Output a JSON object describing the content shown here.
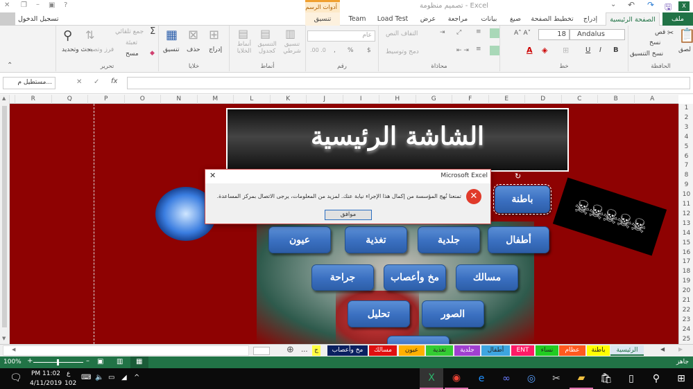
{
  "title": {
    "text": "تصميم منظومة - Excel",
    "context_group": "أدوات الرسم",
    "signin": "تسجيل الدخول"
  },
  "tabs": [
    "ملف",
    "الصفحة الرئيسية",
    "إدراج",
    "تخطيط الصفحة",
    "صيغ",
    "بيانات",
    "مراجعة",
    "عرض",
    "Load Test",
    "Team",
    "تنسيق"
  ],
  "ribbon": {
    "clipboard": {
      "label": "الحافظة",
      "paste": "لصق",
      "cut": "قص",
      "copy": "نسخ",
      "format_painter": "نسخ التنسيق"
    },
    "font": {
      "label": "خط",
      "name": "Andalus",
      "size": "18",
      "bold": "B",
      "italic": "I",
      "underline": "U"
    },
    "alignment": {
      "label": "محاذاة",
      "wrap": "التفاف النص",
      "merge": "دمج وتوسيط"
    },
    "number": {
      "label": "رقم",
      "format": "عام",
      "currency": "$",
      "percent": "%",
      "comma": ","
    },
    "styles": {
      "label": "أنماط",
      "conditional": "تنسيق شرطي",
      "as_table": "التنسيق كجدول",
      "cell_styles": "أنماط الخلايا"
    },
    "cells": {
      "label": "خلايا",
      "insert": "إدراج",
      "delete": "حذف",
      "format": "تنسيق"
    },
    "editing": {
      "label": "تحرير",
      "autosum": "جمع تلقائي",
      "fill": "تعبئة",
      "clear": "مسح",
      "sort": "فرز وتصفية",
      "find": "بحث وتحديد"
    }
  },
  "formula_bar": {
    "name_box": "مستطيل م...",
    "cancel": "✕",
    "enter": "✓",
    "fx": "fx",
    "value": ""
  },
  "columns": [
    "A",
    "B",
    "C",
    "D",
    "E",
    "F",
    "G",
    "H",
    "I",
    "J",
    "K",
    "L",
    "M",
    "N",
    "O",
    "P",
    "Q",
    "R"
  ],
  "rows": [
    "1",
    "2",
    "3",
    "4",
    "5",
    "6",
    "7",
    "8",
    "9",
    "10",
    "11",
    "12",
    "13",
    "14",
    "15",
    "16",
    "17",
    "18",
    "19",
    "20",
    "21",
    "22",
    "23",
    "24",
    "25"
  ],
  "sheet": {
    "header_title": "الشاشة الرئيسية",
    "buttons": [
      {
        "id": "batna",
        "label": "باطنة"
      },
      {
        "id": "atfal",
        "label": "أطفال"
      },
      {
        "id": "jildiya",
        "label": "جلدية"
      },
      {
        "id": "taghdhiya",
        "label": "تغذية"
      },
      {
        "id": "oyoun",
        "label": "عيون"
      },
      {
        "id": "masalik",
        "label": "مسالك"
      },
      {
        "id": "mokh",
        "label": "مخ وأعصاب"
      },
      {
        "id": "jiraha",
        "label": "جراحة"
      },
      {
        "id": "sowar",
        "label": "الصور"
      },
      {
        "id": "tahlil",
        "label": "تحليل"
      }
    ]
  },
  "dialog": {
    "title": "Microsoft Excel",
    "message": "تمنعنا نُهج المؤسسة من إكمال هذا الإجراء نيابة عنك. لمزيد من المعلومات، يرجى الاتصال بمركز المساعدة.",
    "ok": "موافق",
    "close": "✕"
  },
  "sheet_tabs": [
    {
      "label": "الرئيسية",
      "color": "#dbe6f1",
      "active": true
    },
    {
      "label": "باطنة",
      "color": "#ffff00"
    },
    {
      "label": "عظام",
      "color": "#ff5a1f"
    },
    {
      "label": "نساء",
      "color": "#22cc22"
    },
    {
      "label": "ENT",
      "color": "#ff1a66"
    },
    {
      "label": "أطفال",
      "color": "#3da5e0"
    },
    {
      "label": "جلدية",
      "color": "#a040d0"
    },
    {
      "label": "تغذية",
      "color": "#33cc33"
    },
    {
      "label": "عيون",
      "color": "#ffb000"
    },
    {
      "label": "مسالك",
      "color": "#e01010"
    },
    {
      "label": "مخ وأعصاب",
      "color": "#0a2060"
    },
    {
      "label": "ج",
      "color": "#ffff40"
    }
  ],
  "sheet_tabs_more": "...",
  "status": {
    "ready": "جاهز",
    "zoom": "100%"
  },
  "taskbar": {
    "time": "PM 11:02",
    "date": "4/11/2019",
    "lang": "ع",
    "lang_num": "102"
  }
}
